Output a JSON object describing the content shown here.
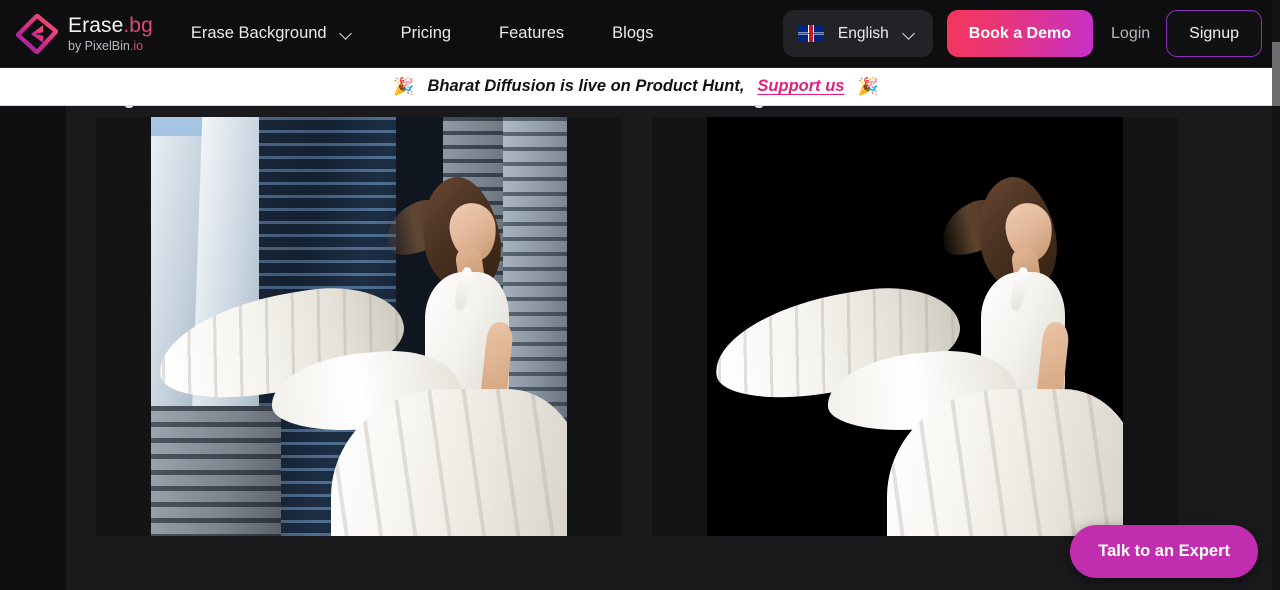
{
  "brand": {
    "name": "Erase",
    "name_suffix": ".bg",
    "tagline_prefix": "by PixelBin",
    "tagline_suffix": ".io",
    "logo_icon": "erase-bg-diamond-logo",
    "accent_color": "#e0457b"
  },
  "nav": {
    "links": [
      {
        "label": "Erase Background",
        "has_dropdown": true
      },
      {
        "label": "Pricing",
        "has_dropdown": false
      },
      {
        "label": "Features",
        "has_dropdown": false
      },
      {
        "label": "Blogs",
        "has_dropdown": false
      }
    ],
    "language": {
      "label": "English",
      "flag": "uk-flag-icon",
      "chevron": "chevron-down-icon"
    },
    "demo_button": "Book a Demo",
    "login_button": "Login",
    "signup_button": "Signup",
    "demo_gradient_from": "#f5365c",
    "demo_gradient_to": "#c531c9",
    "signup_border_color": "#8c2fb8"
  },
  "announcement": {
    "emoji_left": "🎉",
    "emoji_right": "🎉",
    "text": "Bharat Diffusion is live on Product Hunt,",
    "link_label": "Support us",
    "link_color": "#e51e7c",
    "background": "#ffffff"
  },
  "compare": {
    "columns": [
      {
        "title": "Original",
        "variant": "city-background-photo"
      },
      {
        "title": "Black Background",
        "variant": "black-background-photo"
      }
    ]
  },
  "cta": {
    "expert_button": "Talk to an Expert",
    "color": "#c22cae"
  },
  "scrollbar": {
    "orientation": "vertical",
    "thumb_color": "#6d6d72"
  }
}
